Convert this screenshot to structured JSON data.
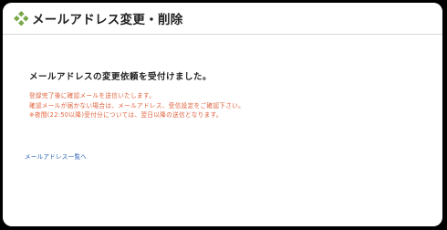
{
  "header": {
    "title": "メールアドレス変更・削除",
    "icon": "diamond-cluster-icon",
    "accent_color": "#79a84a"
  },
  "main": {
    "heading": "メールアドレスの変更依頼を受付けました。",
    "notes": [
      "登録完了後に確認メールを送信いたします。",
      "確認メールが届かない場合は、メールアドレス、受信設定をご確認下さい。",
      "※夜間(22:50以降)受付分については、翌日以降の送信となります。"
    ],
    "note_color": "#e0603a",
    "back_link": "メールアドレス一覧へ",
    "link_color": "#2f66b8"
  }
}
